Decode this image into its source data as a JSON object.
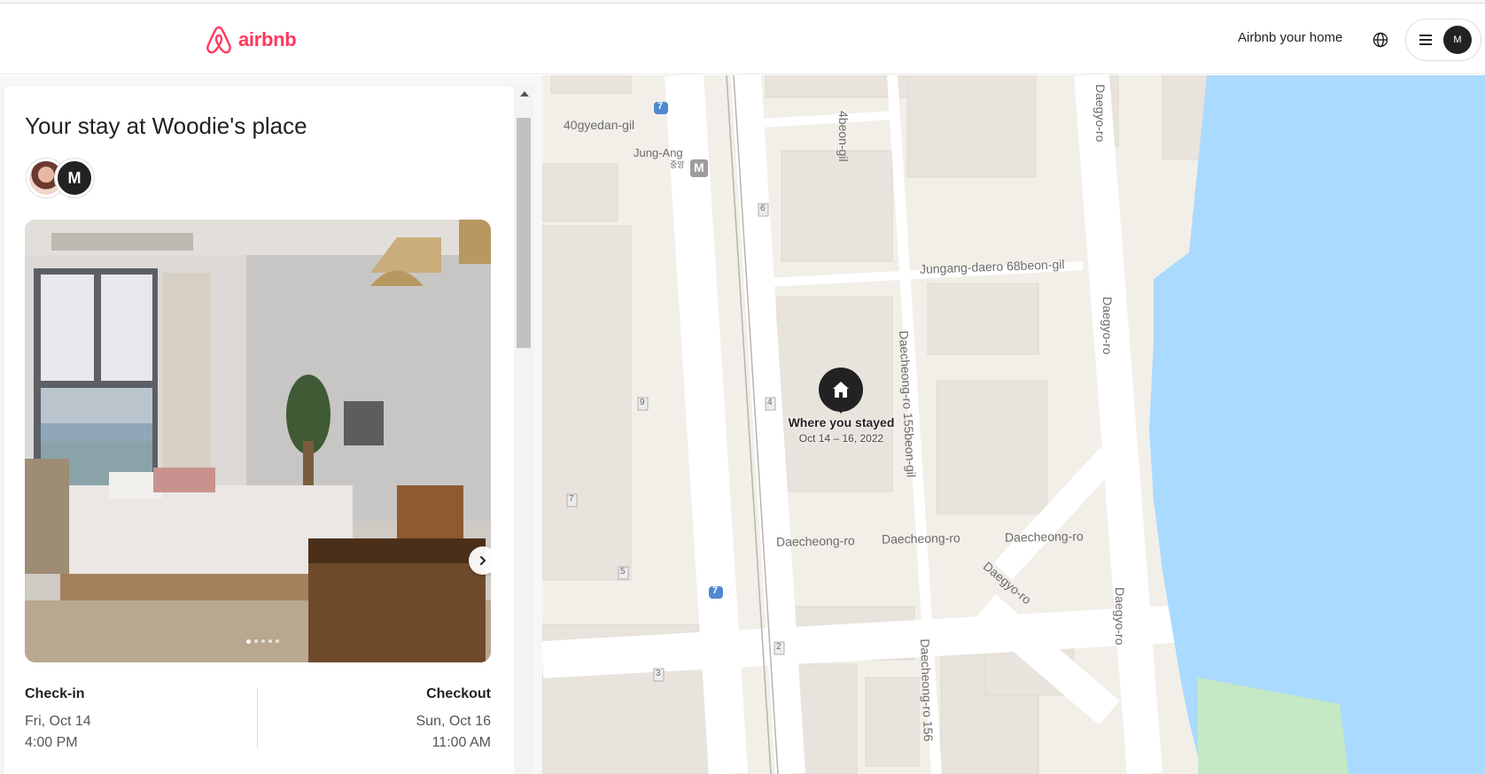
{
  "header": {
    "logo_text": "airbnb",
    "host_link": "Airbnb your home",
    "globe_icon": "globe-icon",
    "menu_icon": "hamburger-menu-icon",
    "user_initial": "M",
    "brand_color": "#ff385c"
  },
  "stay": {
    "title": "Your stay at Woodie's place",
    "guest_initial": "M",
    "photo": {
      "count": 5,
      "active_index": 0,
      "next_icon": "chevron-right-icon"
    },
    "checkin": {
      "label": "Check-in",
      "date": "Fri, Oct 14",
      "time": "4:00 PM"
    },
    "checkout": {
      "label": "Checkout",
      "date": "Sun, Oct 16",
      "time": "11:00 AM"
    }
  },
  "map": {
    "pin_icon": "house-icon",
    "pin_title": "Where you stayed",
    "pin_dates": "Oct 14 – 16, 2022",
    "labels": {
      "gil40": "40gyedan-gil",
      "jungang": "Jung-Ang",
      "jungang_kr": "중앙",
      "beon4": "4beon-gil",
      "daegyo_top": "Daegyo-ro",
      "jungang_daero": "Jungang-daero 68beon-gil",
      "daegyo_mid": "Daegyo-ro",
      "daecheong155": "Daecheong-ro 155beon-gil",
      "daecheong1": "Daecheong-ro",
      "daecheong2": "Daecheong-ro",
      "daecheong3": "Daecheong-ro",
      "daegyo_diag": "Daegyo-ro",
      "daegyo_bottom": "Daegyo-ro",
      "daecheong156": "Daecheong-ro 156"
    },
    "markers": {
      "route7a": "7",
      "route7b": "7",
      "metro": "M",
      "b6": "6",
      "b9": "9",
      "b4": "4",
      "b7": "7",
      "b5": "5",
      "b2": "2",
      "b3": "3"
    },
    "water_color": "#aadaff",
    "park_color": "#c5e8c5"
  }
}
